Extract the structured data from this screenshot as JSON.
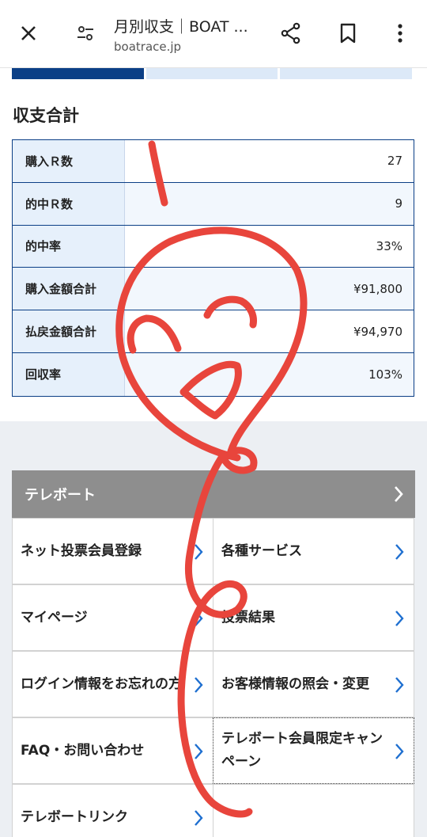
{
  "browser": {
    "title": "月別収支｜BOAT ...",
    "url": "boatrace.jp",
    "icons": [
      "close-icon",
      "site-settings-icon",
      "share-icon",
      "bookmark-icon",
      "more-vert-icon"
    ]
  },
  "tabs": {
    "colors": [
      "#0b3f86",
      "#dce9f8",
      "#dce9f8"
    ]
  },
  "summary": {
    "title": "収支合計",
    "rows": [
      {
        "label": "購入Ｒ数",
        "value": "27"
      },
      {
        "label": "的中Ｒ数",
        "value": "9"
      },
      {
        "label": "的中率",
        "value": "33%"
      },
      {
        "label": "購入金額合計",
        "value": "¥91,800"
      },
      {
        "label": "払戻金額合計",
        "value": "¥94,970"
      },
      {
        "label": "回収率",
        "value": "103%"
      }
    ]
  },
  "telebo": {
    "header": "テレボート",
    "links": [
      "ネット投票会員登録",
      "各種サービス",
      "マイページ",
      "投票結果",
      "ログイン情報をお忘れの方",
      "お客様情報の照会・変更",
      "FAQ・お問い合わせ",
      "テレボート会員限定キャンペーン",
      "テレボートリンク"
    ]
  },
  "colors": {
    "accent_blue": "#0b3f86",
    "label_bg": "#e6f0fb",
    "header_gray": "#8e8e8e",
    "arrow_blue": "#1e6fd0",
    "scribble_red": "#e8453c"
  }
}
